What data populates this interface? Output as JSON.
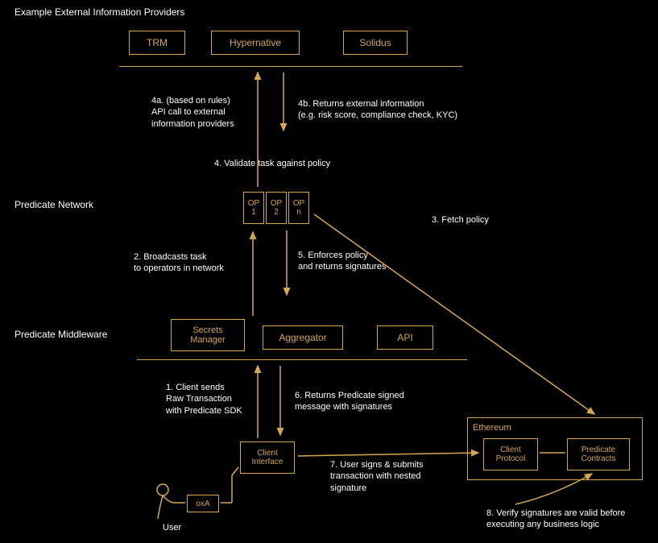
{
  "sections": {
    "external_providers_title": "Example External Information Providers",
    "predicate_network_title": "Predicate Network",
    "predicate_middleware_title": "Predicate Middleware"
  },
  "providers": {
    "trm": "TRM",
    "hypernative": "Hypernative",
    "solidus": "Solidus"
  },
  "operators": {
    "op1_line1": "OP",
    "op1_line2": "1",
    "op2_line1": "OP",
    "op2_line2": "2",
    "opn_line1": "OP",
    "opn_line2": "n"
  },
  "middleware": {
    "secrets": "Secrets\nManager",
    "aggregator": "Aggregator",
    "api": "API"
  },
  "client_interface": "Client\nInterface",
  "ethereum": {
    "title": "Ethereum",
    "client_protocol": "Client\nProtocol",
    "predicate_contracts": "Predicate\nContracts"
  },
  "user": {
    "label": "User",
    "address": "oxA"
  },
  "steps": {
    "s1": "1. Client sends\nRaw Transaction\nwith Predicate SDK",
    "s2": "2. Broadcasts task\nto operators in network",
    "s3": "3. Fetch policy",
    "s4": "4. Validate task against policy",
    "s4a": "4a. (based on rules)\nAPI call to external\ninformation providers",
    "s4b": "4b. Returns external information\n(e.g. risk score, compliance check, KYC)",
    "s5": "5. Enforces policy\nand returns signatures",
    "s6": "6. Returns Predicate signed\nmessage with signatures",
    "s7": "7. User signs & submits\ntransaction with nested\nsignature",
    "s8": "8. Verify signatures are valid before\nexecuting any business logic"
  }
}
